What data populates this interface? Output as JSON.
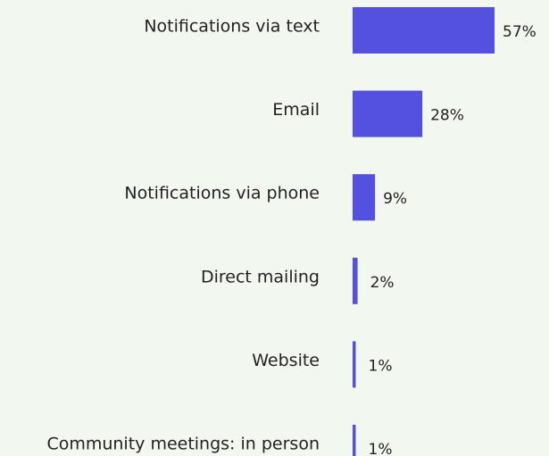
{
  "chart_data": {
    "type": "bar",
    "orientation": "horizontal",
    "categories": [
      "Notifications via text",
      "Email",
      "Notifications via phone",
      "Direct mailing",
      "Website",
      "Community meetings: in person"
    ],
    "values": [
      57,
      28,
      9,
      2,
      1,
      1
    ],
    "value_labels": [
      "57%",
      "28%",
      "9%",
      "2%",
      "1%",
      "1%"
    ],
    "title": "",
    "xlabel": "",
    "ylabel": "",
    "xlim": [
      0,
      57
    ],
    "grid": false,
    "legend": "none",
    "bar_color": "#5451e0",
    "background": "#f2f7ef"
  }
}
